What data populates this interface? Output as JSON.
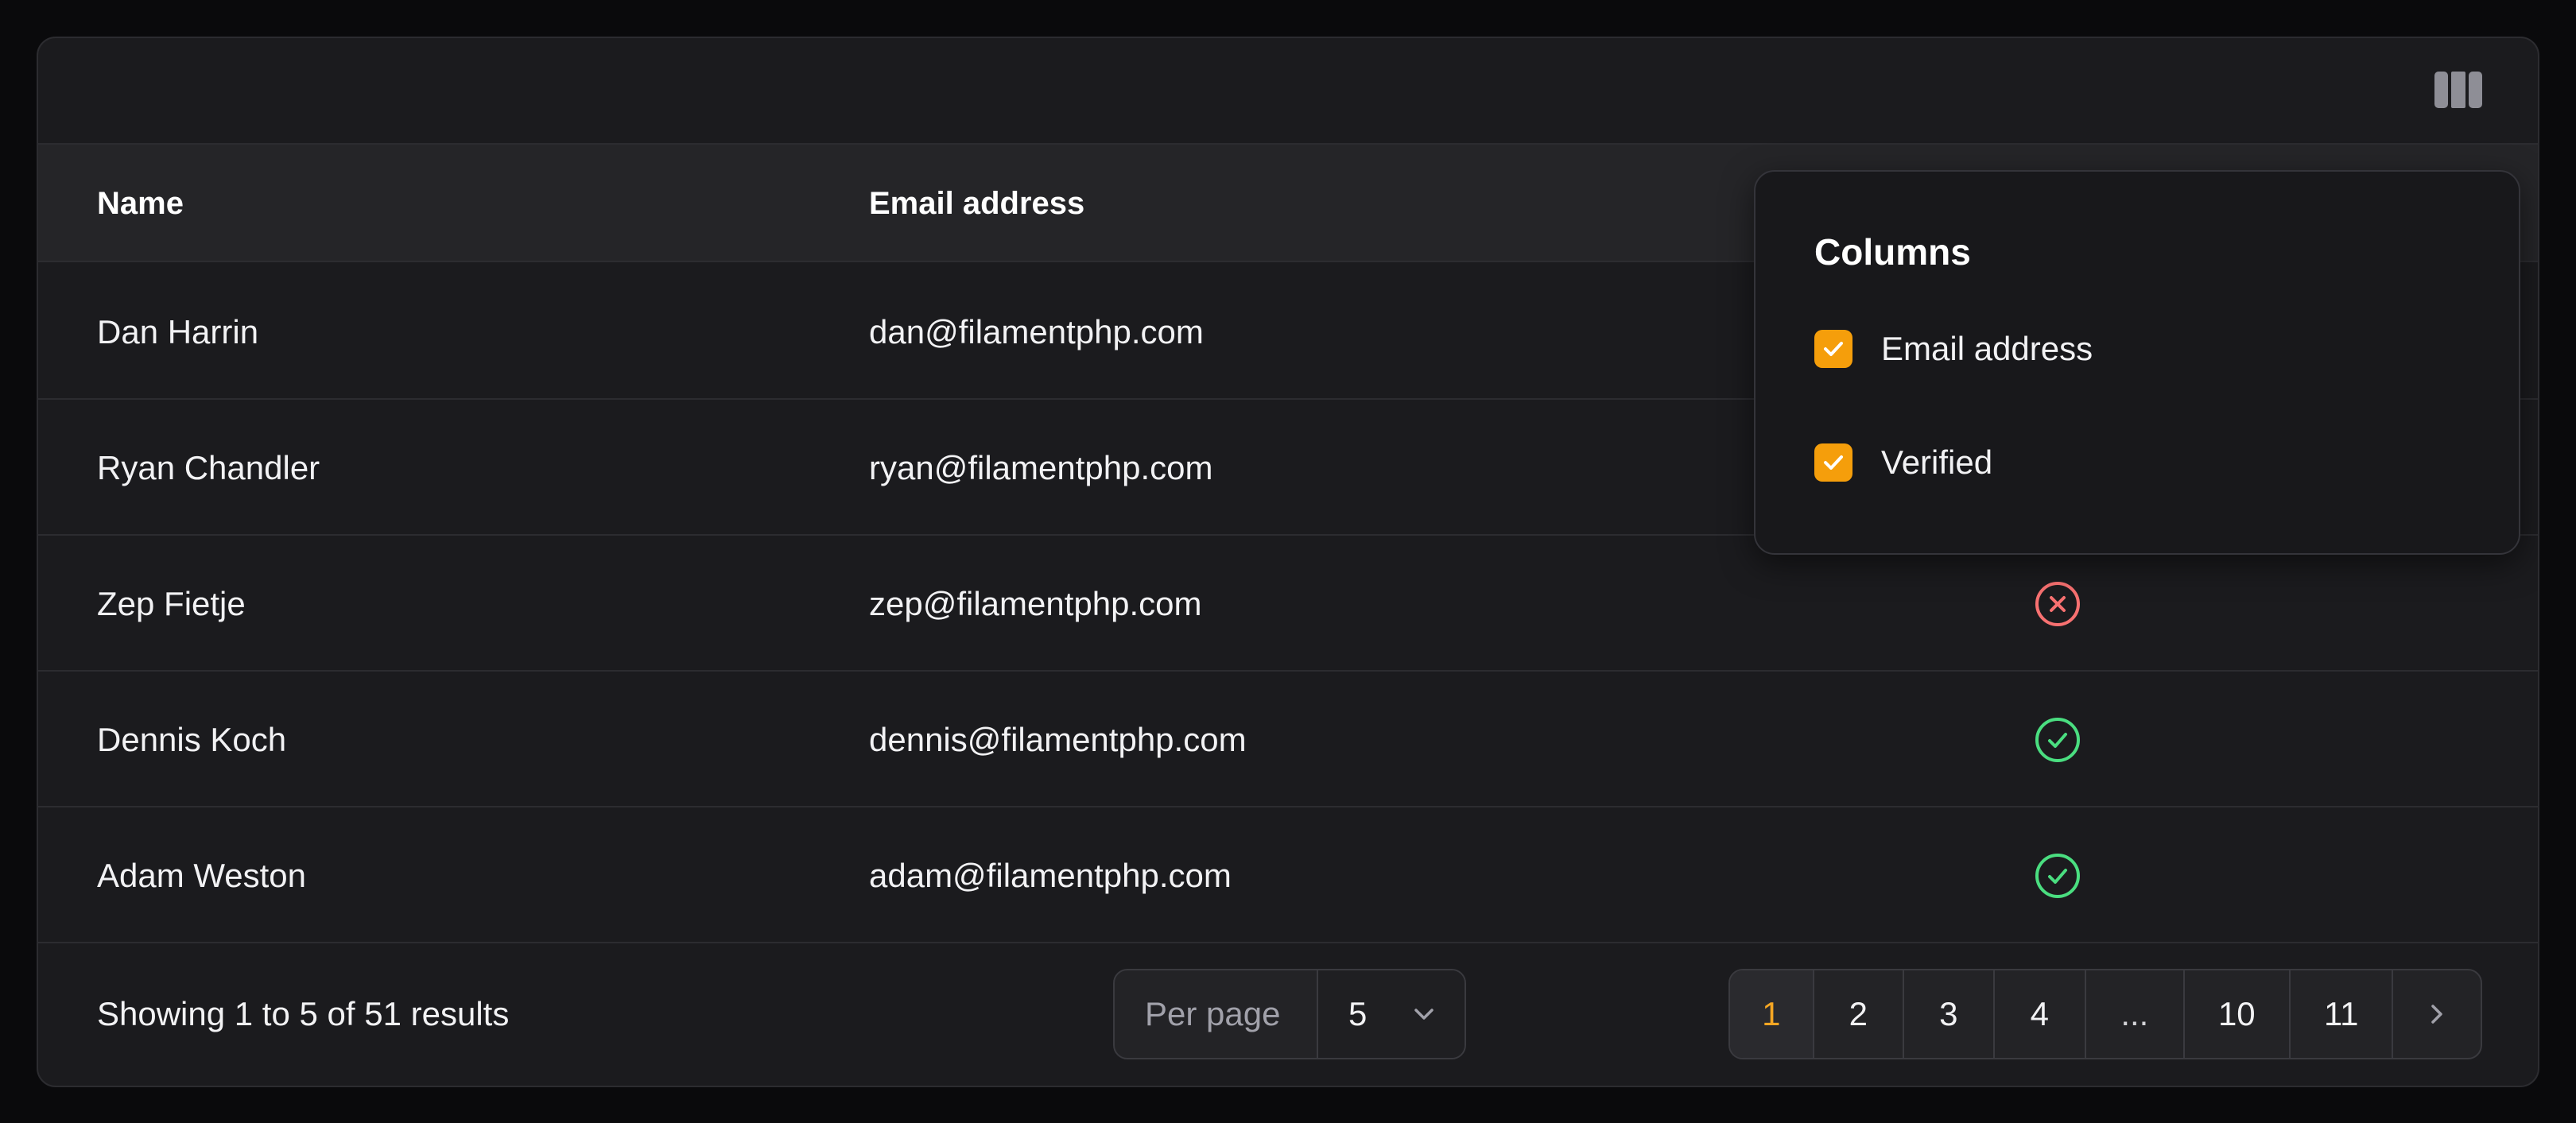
{
  "table": {
    "headers": {
      "name": "Name",
      "email": "Email address"
    },
    "rows": [
      {
        "name": "Dan Harrin",
        "email": "dan@filamentphp.com",
        "verified": null
      },
      {
        "name": "Ryan Chandler",
        "email": "ryan@filamentphp.com",
        "verified": null
      },
      {
        "name": "Zep Fietje",
        "email": "zep@filamentphp.com",
        "verified": false
      },
      {
        "name": "Dennis Koch",
        "email": "dennis@filamentphp.com",
        "verified": true
      },
      {
        "name": "Adam Weston",
        "email": "adam@filamentphp.com",
        "verified": true
      }
    ]
  },
  "icons": {
    "columns_toggle": "view-columns-icon",
    "verified_true": "check-circle-icon",
    "verified_false": "x-circle-icon",
    "select_chevron": "chevron-down-icon",
    "next_page": "chevron-right-icon",
    "checkbox_check": "check-icon"
  },
  "columns_dropdown": {
    "title": "Columns",
    "options": [
      {
        "label": "Email address",
        "checked": true
      },
      {
        "label": "Verified",
        "checked": true
      }
    ]
  },
  "footer": {
    "summary": "Showing 1 to 5 of 51 results",
    "per_page_label": "Per page",
    "per_page_value": "5",
    "pages": [
      "1",
      "2",
      "3",
      "4",
      "...",
      "10",
      "11"
    ],
    "current_page": "1"
  },
  "colors": {
    "accent": "#f59e0b",
    "active_page": "#f5a623",
    "success": "#4ade80",
    "danger": "#f87171"
  }
}
